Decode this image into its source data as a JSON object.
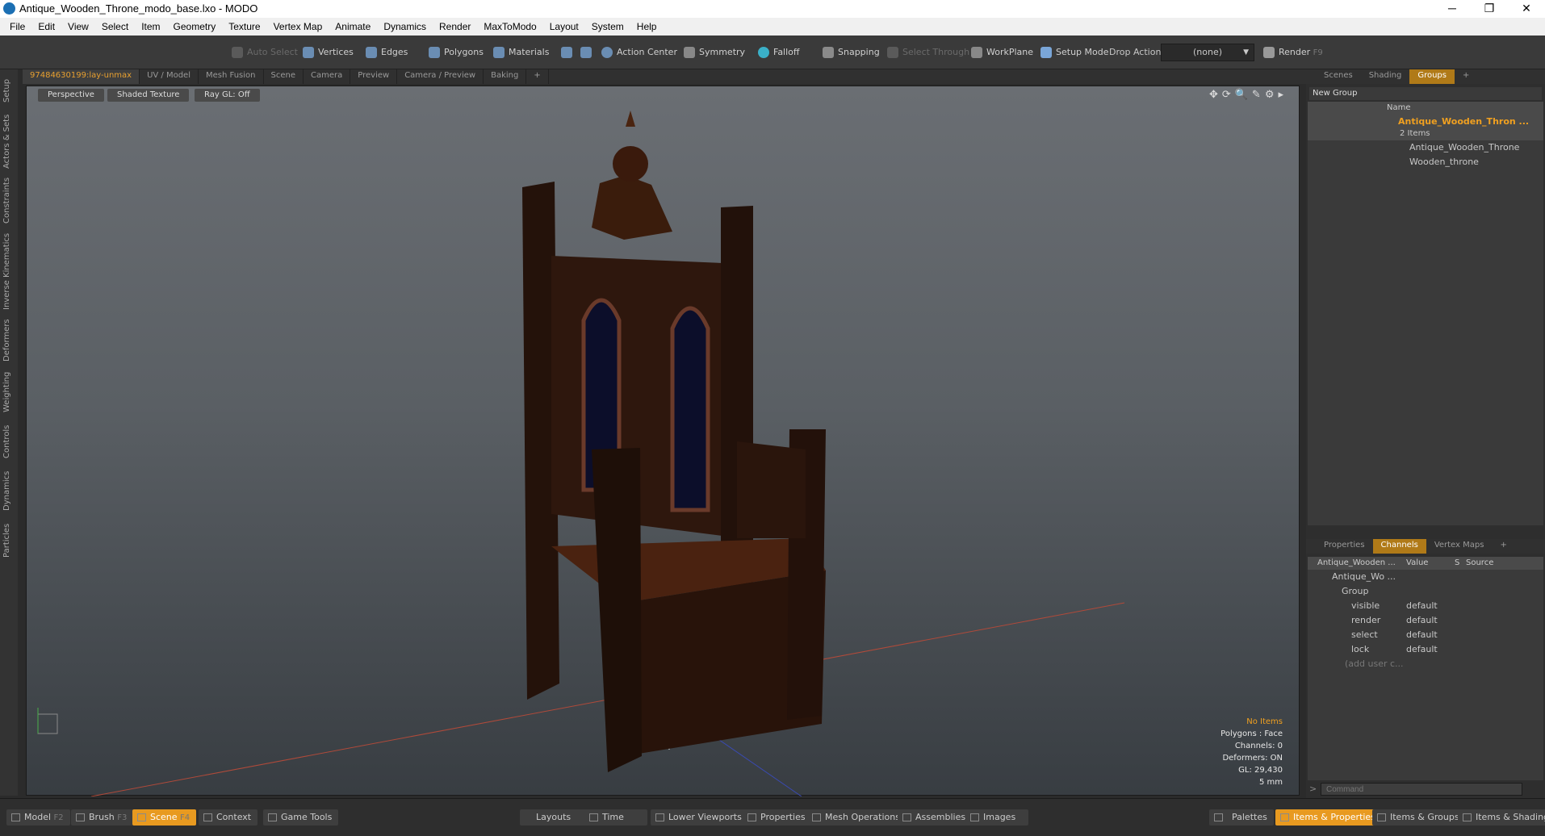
{
  "window": {
    "title": "Antique_Wooden_Throne_modo_base.lxo - MODO",
    "min": "─",
    "restore": "❐",
    "close": "✕"
  },
  "menu": [
    "File",
    "Edit",
    "View",
    "Select",
    "Item",
    "Geometry",
    "Texture",
    "Vertex Map",
    "Animate",
    "Dynamics",
    "Render",
    "MaxToModo",
    "Layout",
    "System",
    "Help"
  ],
  "toolbar": {
    "auto_select": "Auto Select",
    "vertices": "Vertices",
    "edges": "Edges",
    "polygons": "Polygons",
    "materials": "Materials",
    "action_center": "Action Center",
    "symmetry": "Symmetry",
    "falloff": "Falloff",
    "snapping": "Snapping",
    "select_through": "Select Through",
    "workplane": "WorkPlane",
    "setup_mode": "Setup Mode",
    "drop_action": "Drop Action",
    "drop_value": "(none)",
    "render": "Render",
    "render_key": "F9"
  },
  "left_tabs": [
    "Setup",
    "Actors & Sets",
    "Constraints",
    "Inverse Kinematics",
    "Deformers",
    "Weighting",
    "Controls",
    "Dynamics",
    "Particles"
  ],
  "viewport_tabs": [
    "97484630199:lay-unmax",
    "UV / Model",
    "Mesh Fusion",
    "Scene",
    "Camera",
    "Preview",
    "Camera / Preview",
    "Baking",
    "+"
  ],
  "viewport": {
    "view": "Perspective",
    "shading": "Shaded Texture",
    "raygl": "Ray GL: Off"
  },
  "info": {
    "items": "No Items",
    "polygons": "Polygons : Face",
    "channels": "Channels: 0",
    "deformers": "Deformers: ON",
    "gl": "GL: 29,430",
    "scale": "5 mm"
  },
  "right_tabs": [
    "Scenes",
    "Shading",
    "Groups",
    "+"
  ],
  "groups": {
    "new_group": "New Group",
    "name_col": "Name",
    "group_name": "Antique_Wooden_Thron ...",
    "count": "2 Items",
    "children": [
      "Antique_Wooden_Throne",
      "Wooden_throne"
    ]
  },
  "prop_tabs": [
    "Properties",
    "Channels",
    "Vertex Maps",
    "+"
  ],
  "channels": {
    "col_name": "Antique_Wooden ...",
    "col_value": "Value",
    "col_s": "S",
    "col_source": "Source",
    "item": "Antique_Wo ...",
    "group": "Group",
    "rows": [
      {
        "name": "visible",
        "value": "default"
      },
      {
        "name": "render",
        "value": "default"
      },
      {
        "name": "select",
        "value": "default"
      },
      {
        "name": "lock",
        "value": "default"
      }
    ],
    "add": "(add user c..."
  },
  "command": {
    "placeholder": "Command"
  },
  "bottom": {
    "model": "Model",
    "model_key": "F2",
    "brush": "Brush",
    "brush_key": "F3",
    "scene": "Scene",
    "scene_key": "F4",
    "context": "Context",
    "game_tools": "Game Tools",
    "layouts": "Layouts",
    "time": "Time",
    "lower_viewports": "Lower Viewports",
    "properties": "Properties",
    "mesh_operations": "Mesh Operations",
    "assemblies": "Assemblies",
    "images": "Images",
    "palettes": "Palettes",
    "items_properties": "Items & Properties",
    "items_groups": "Items & Groups",
    "items_shading": "Items & Shading"
  }
}
